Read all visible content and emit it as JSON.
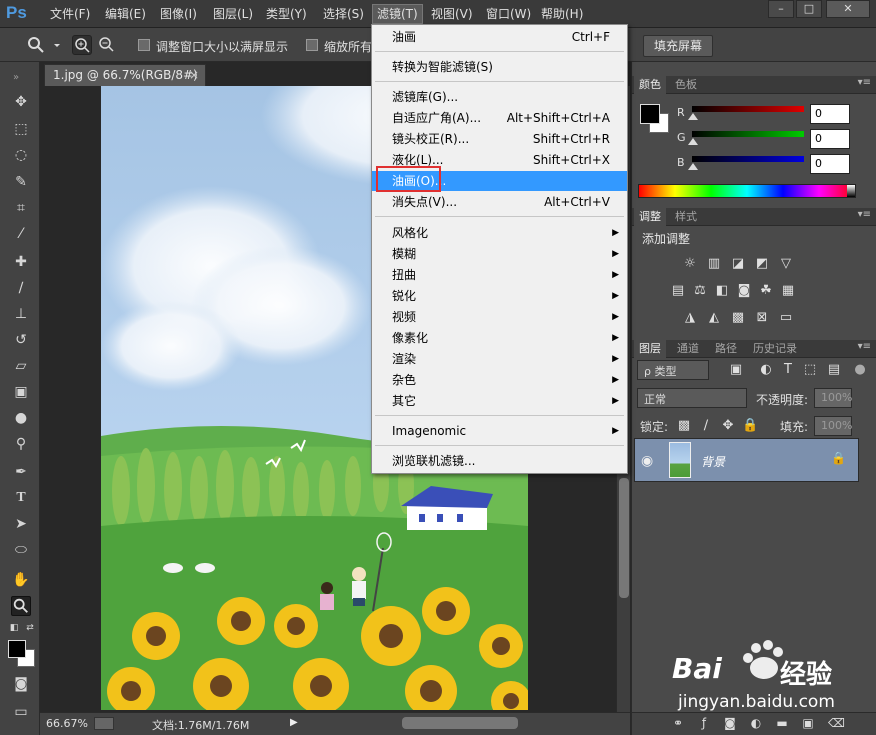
{
  "app": {
    "logo": "Ps"
  },
  "menubar": {
    "items": [
      "文件(F)",
      "编辑(E)",
      "图像(I)",
      "图层(L)",
      "类型(Y)",
      "选择(S)",
      "滤镜(T)",
      "视图(V)",
      "窗口(W)",
      "帮助(H)"
    ],
    "active_index": 6
  },
  "window_controls": [
    "–",
    "□",
    "✕"
  ],
  "optionsbar": {
    "resize_label": "调整窗口大小以满屏显示",
    "zoom_all_label": "缩放所有",
    "fill_screen_button": "填充屏幕"
  },
  "document": {
    "tab_title": "1.jpg @ 66.7%(RGB/8#)",
    "close": "×"
  },
  "status": {
    "zoom": "66.67%",
    "doc_info": "文档:1.76M/1.76M",
    "arrow": "▶"
  },
  "filter_menu": {
    "items": [
      {
        "label": "油画",
        "shortcut": "Ctrl+F"
      },
      {
        "label": "转换为智能滤镜(S)"
      },
      {
        "label": "滤镜库(G)..."
      },
      {
        "label": "自适应广角(A)...",
        "shortcut": "Alt+Shift+Ctrl+A"
      },
      {
        "label": "镜头校正(R)...",
        "shortcut": "Shift+Ctrl+R"
      },
      {
        "label": "液化(L)...",
        "shortcut": "Shift+Ctrl+X"
      },
      {
        "label": "油画(O)...",
        "highlighted": true
      },
      {
        "label": "消失点(V)...",
        "shortcut": "Alt+Ctrl+V"
      },
      {
        "label": "风格化",
        "submenu": true
      },
      {
        "label": "模糊",
        "submenu": true
      },
      {
        "label": "扭曲",
        "submenu": true
      },
      {
        "label": "锐化",
        "submenu": true
      },
      {
        "label": "视频",
        "submenu": true
      },
      {
        "label": "像素化",
        "submenu": true
      },
      {
        "label": "渲染",
        "submenu": true
      },
      {
        "label": "杂色",
        "submenu": true
      },
      {
        "label": "其它",
        "submenu": true
      },
      {
        "label": "Imagenomic",
        "submenu": true
      },
      {
        "label": "浏览联机滤镜..."
      }
    ]
  },
  "color_panel": {
    "tabs": [
      "颜色",
      "色板"
    ],
    "menu": "▾≡",
    "r_label": "R",
    "g_label": "G",
    "b_label": "B",
    "r_value": "0",
    "g_value": "0",
    "b_value": "0",
    "r_color": "#cc1111",
    "g_color": "#11aa11",
    "b_color": "#1122cc"
  },
  "adjust_panel": {
    "tabs": [
      "调整",
      "样式"
    ],
    "menu": "▾≡",
    "title": "添加调整"
  },
  "layers_panel": {
    "tabs": [
      "图层",
      "通道",
      "路径",
      "历史记录"
    ],
    "menu": "▾≡",
    "kind_filter": "ρ 类型",
    "blend_mode": "正常",
    "opacity_label": "不透明度:",
    "opacity_value": "100%",
    "lock_label": "锁定:",
    "fill_label": "填充:",
    "fill_value": "100%",
    "layer_name": "背景"
  },
  "watermark": {
    "brand": "Bai",
    "brand2": "经验",
    "url": "jingyan.baidu.com"
  }
}
